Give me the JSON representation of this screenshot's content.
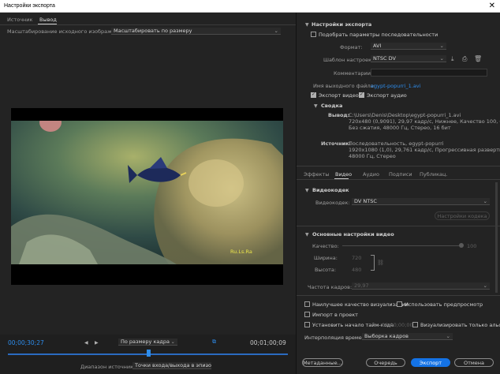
{
  "window": {
    "title": "Настройки экспорта",
    "close": "✕"
  },
  "left": {
    "tabs": [
      "Источник",
      "Вывод"
    ],
    "scaling_label": "Масштабирование исходного изображения:",
    "scaling_value": "Масштабировать по размеру",
    "overlay_text": "Ru.Ls.Ra",
    "timecode_current": "00;00;30;27",
    "timecode_end": "00;01;00;09",
    "fit_select": "По размеру кадра",
    "source_range_label": "Диапазон источника:",
    "source_range_value": "Точки входа/выхода в эпизо..."
  },
  "export_settings": {
    "header": "Настройки экспорта",
    "match_sequence": "Подобрать параметры последовательности",
    "format_label": "Формат:",
    "format_value": "AVI",
    "preset_label": "Шаблон настроек:",
    "preset_value": "NTSC DV",
    "comment_label": "Комментарии:",
    "output_label": "Имя выходного файла:",
    "output_value": "egypt-popurri_1.avi",
    "export_video": "Экспорт видео",
    "export_audio": "Экспорт аудио"
  },
  "summary": {
    "header": "Сводка",
    "output_label": "Вывод:",
    "output_lines": [
      "C:\\Users\\Denis\\Desktop\\egypt-popurri_1.avi",
      "720x480 (0,9091), 29,97 кадр/с, Нижнее, Качество 100, 00;...",
      "Без сжатия, 48000 Гц, Стерео, 16 бит"
    ],
    "source_label": "Источник:",
    "source_lines": [
      "Последовательность, egypt-popurri",
      "1920x1080 (1,0), 29,761 кадр/с, Прогрессивная развертка,...",
      "48000 Гц, Стерео"
    ]
  },
  "tabs2": [
    "Эффекты",
    "Видео",
    "Аудио",
    "Подписи",
    "Публикац."
  ],
  "video_codec": {
    "header": "Видеокодек",
    "codec_label": "Видеокодек:",
    "codec_value": "DV NTSC",
    "codec_settings_btn": "Настройки кодека"
  },
  "basic_video": {
    "header": "Основные настройки видео",
    "quality_label": "Качество:",
    "quality_value": "100",
    "width_label": "Ширина:",
    "width_value": "720",
    "height_label": "Высота:",
    "height_value": "480",
    "framerate_label": "Частота кадров:",
    "framerate_value": "29,97"
  },
  "options": {
    "max_quality": "Наилучшее качество визуализации",
    "use_previews": "Использовать предпросмотр",
    "import_project": "Импорт в проект",
    "set_timecode": "Установить начало тайм-кода",
    "timecode_value": "00;00;00;00",
    "alpha_only": "Визуализировать только альфа-кан...",
    "interp_label": "Интерполяция времени:",
    "interp_value": "Выборка кадров"
  },
  "buttons": {
    "metadata": "Метаданные...",
    "queue": "Очередь",
    "export": "Экспорт",
    "cancel": "Отмена"
  },
  "colors": {
    "accent": "#1473e6",
    "link": "#2d8ceb",
    "bg": "#232323"
  },
  "video_preview": {
    "played_fraction": 0.5
  }
}
